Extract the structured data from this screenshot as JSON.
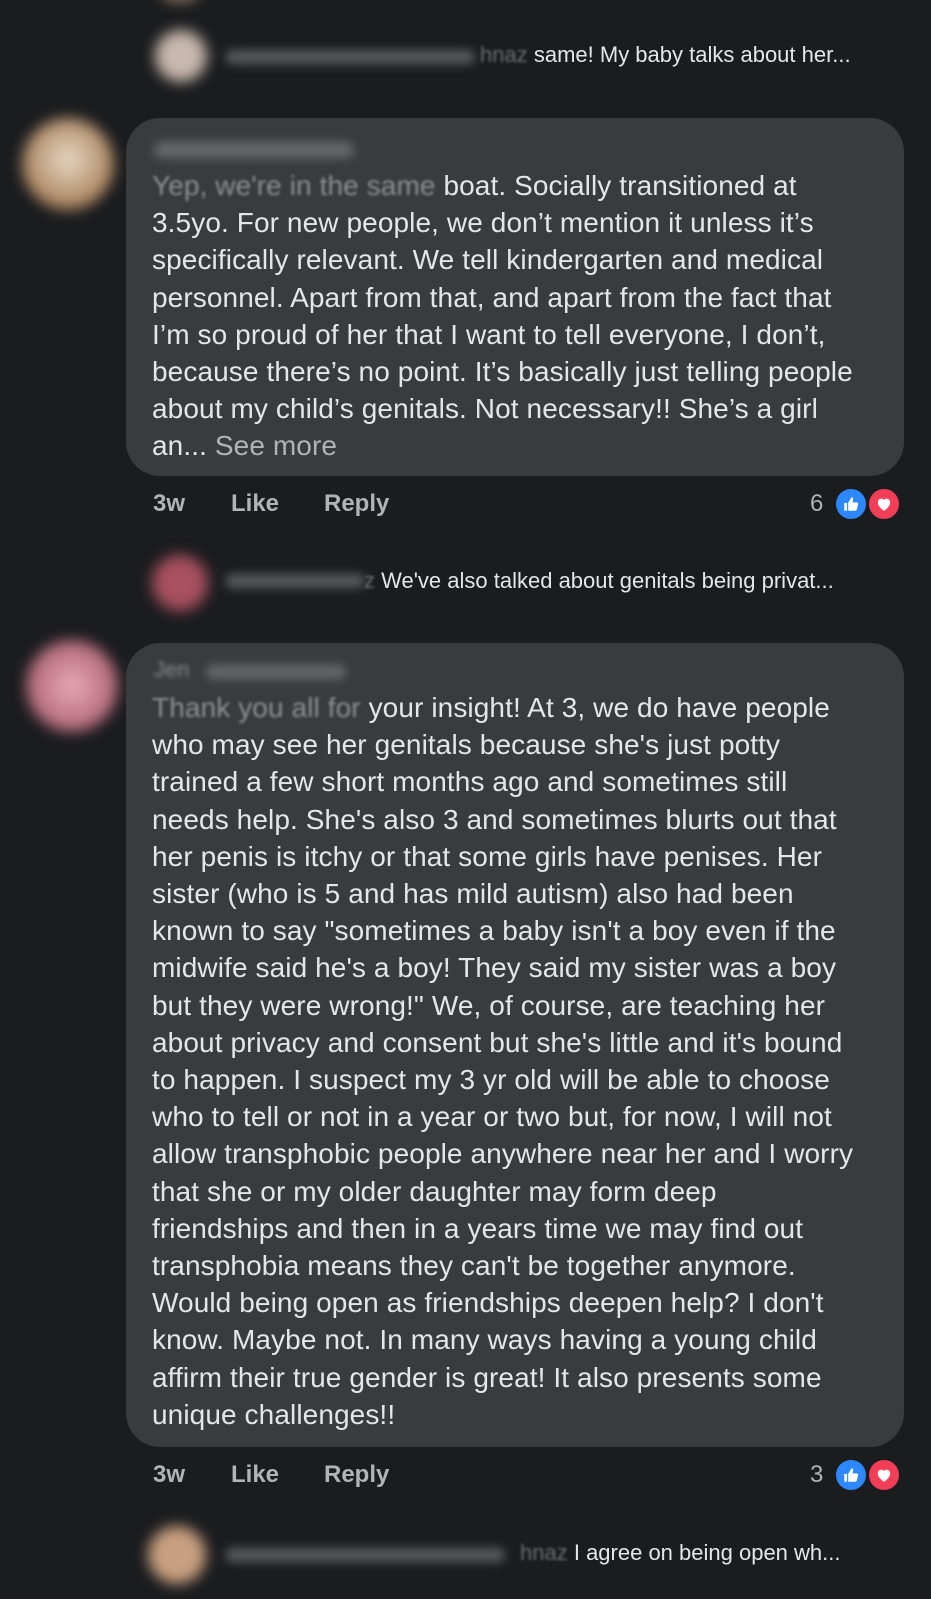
{
  "replies": [
    {
      "name_suffix": "hnaz",
      "text": "same! My baby talks about her..."
    },
    {
      "name_suffix": "z",
      "text": "We've also talked about genitals being privat..."
    },
    {
      "name_suffix": "hnaz",
      "text": "I agree on being open wh..."
    }
  ],
  "comments": [
    {
      "faded_start": "Yep, we're in the same",
      "lines": [
        " boat. Socially transitioned at",
        "3.5yo. For new people, we don’t mention it unless it’s",
        "specifically relevant. We tell kindergarten and medical",
        "personnel. Apart from that, and apart from the fact that",
        "I’m so proud of her that I want to tell everyone, I don’t,",
        "because there’s no point. It’s basically just telling people",
        "about my child’s genitals. Not necessary!! She’s a girl",
        "an... "
      ],
      "see_more": "See more",
      "time": "3w",
      "like_label": "Like",
      "reply_label": "Reply",
      "reaction_count": "6"
    },
    {
      "name_visible": "Jen",
      "faded_start": "Thank you all for",
      "lines": [
        " your insight! At 3, we do have people",
        "who may see her genitals because she's just potty",
        "trained a few short months ago and sometimes still",
        "needs help. She's also 3 and sometimes blurts out that",
        "her penis is itchy or that some girls have penises. Her",
        "sister (who is 5 and has mild autism) also had been",
        "known to say \"sometimes a baby isn't a boy even if the",
        "midwife said he's a boy! They said my sister was a boy",
        "but they were wrong!\" We, of course, are teaching her",
        "about privacy and consent but she's little and it's bound",
        "to happen. I suspect my 3 yr old will be able to choose",
        "who to tell or not in a year or two but, for now, I will not",
        "allow transphobic people anywhere near her and I worry",
        "that she or my older daughter may form deep",
        "friendships and then in a years time we may find out",
        "transphobia means they can't be together anymore.",
        "Would being open as friendships deepen help? I don't",
        "know. Maybe not. In many ways having a young child",
        "affirm their true gender is great! It also presents some",
        "unique challenges!!"
      ],
      "time": "3w",
      "like_label": "Like",
      "reply_label": "Reply",
      "reaction_count": "3"
    }
  ],
  "colors": {
    "like": "#2d88ff",
    "love": "#f33e58",
    "bubble": "#3a3b3c",
    "bg": "#1b1c1e"
  }
}
